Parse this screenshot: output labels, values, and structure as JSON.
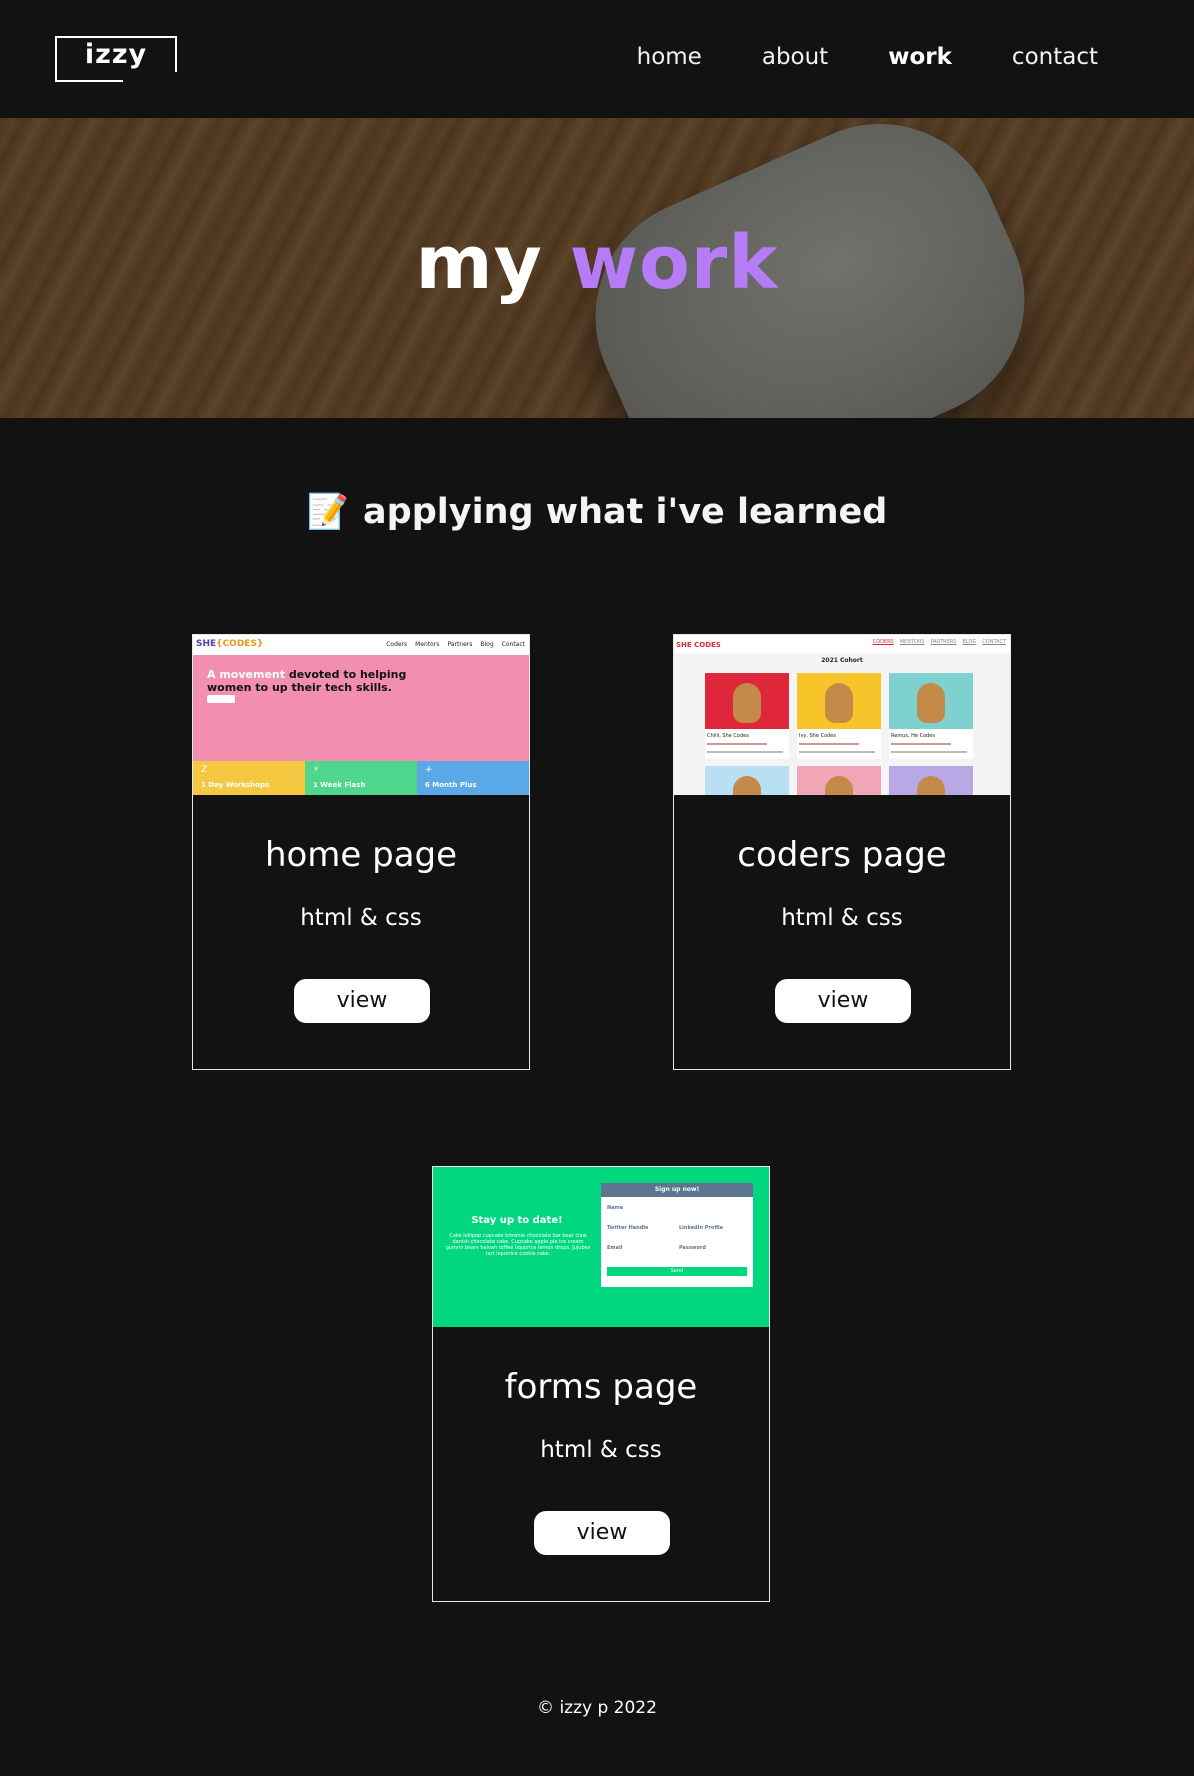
{
  "brand": {
    "logo_text": "izzy"
  },
  "nav": {
    "items": [
      {
        "label": "home",
        "active": false
      },
      {
        "label": "about",
        "active": false
      },
      {
        "label": "work",
        "active": true
      },
      {
        "label": "contact",
        "active": false
      }
    ]
  },
  "hero": {
    "title_part1": "my",
    "title_part2": "work",
    "accent_color": "#b57cf5"
  },
  "section": {
    "emoji": "📝",
    "heading": "applying what i've learned"
  },
  "projects": [
    {
      "title": "home page",
      "tech": "html & css",
      "button_label": "view",
      "thumb": {
        "brand_a": "SHE",
        "brand_b": "{CODES}",
        "menu": [
          "Coders",
          "Mentors",
          "Partners",
          "Blog",
          "Contact"
        ],
        "headline_a": "A movement ",
        "headline_b": "devoted to helping women to up their tech skills.",
        "tiles": [
          {
            "icon": "Z",
            "label": "1 Day Workshops",
            "color": "#f5c842"
          },
          {
            "icon": "⚡",
            "label": "1 Week Flash",
            "color": "#4dd68c"
          },
          {
            "icon": "+",
            "label": "6 Month Plus",
            "color": "#5aa8e6"
          }
        ]
      }
    },
    {
      "title": "coders page",
      "tech": "html & css",
      "button_label": "view",
      "thumb": {
        "brand": "SHE CODES",
        "menu": [
          "CODERS",
          "MENTORS",
          "PARTNERS",
          "BLOG",
          "CONTACT"
        ],
        "cohort": "2021 Cohort",
        "dogs": [
          {
            "name": "Chilli, She Codes",
            "color": "#e0263b"
          },
          {
            "name": "Ivy, She Codes",
            "color": "#f7c52a"
          },
          {
            "name": "Remus, He Codes",
            "color": "#7fd1cf"
          },
          {
            "name": "",
            "color": "#b8e0f2"
          },
          {
            "name": "",
            "color": "#f0a6b6"
          },
          {
            "name": "",
            "color": "#b8a8e6"
          }
        ]
      }
    },
    {
      "title": "forms page",
      "tech": "html & css",
      "button_label": "view",
      "thumb": {
        "cta": "Stay up to date!",
        "cta_sub": "Cake lollipop cupcake brownie chocolate bar bear claw danish chocolate cake. Cupcake apple pie ice cream gummi bears halvah toffee liquorice lemon drops. Jujubes tart liquorice cookie cake.",
        "panel_title": "Sign up now!",
        "fields": [
          "Name",
          "Twitter Handle",
          "LinkedIn Profile",
          "Email",
          "Password"
        ],
        "send": "Send"
      }
    }
  ],
  "footer": {
    "copyright": "© izzy p 2022"
  }
}
